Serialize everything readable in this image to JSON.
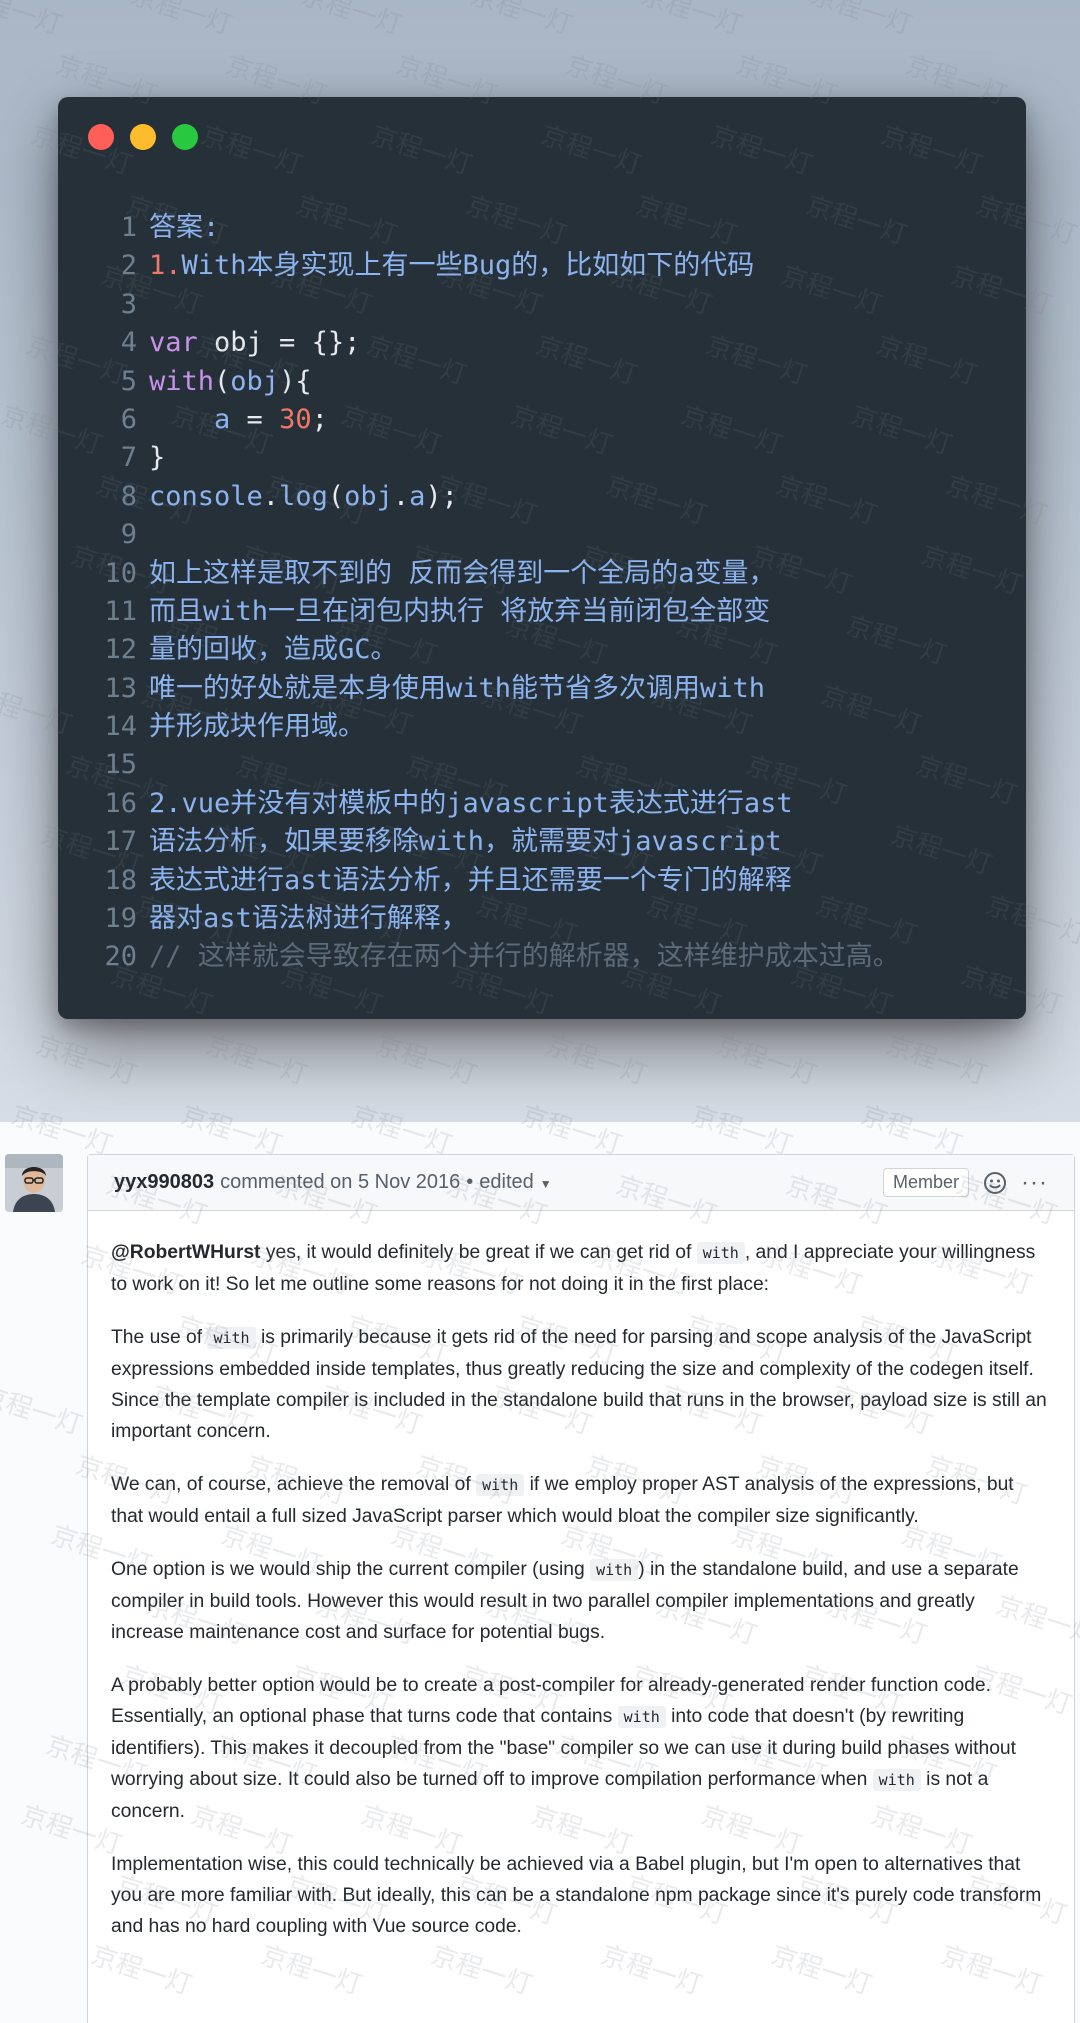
{
  "watermark": "京程一灯",
  "code": {
    "line_numbers": [
      "1",
      "2",
      "3",
      "4",
      "5",
      "6",
      "7",
      "8",
      "9",
      "10",
      "11",
      "12",
      "13",
      "14",
      "15",
      "16",
      "17",
      "18",
      "19",
      "20"
    ],
    "lines": [
      [
        {
          "t": "答案:",
          "c": "text"
        }
      ],
      [
        {
          "t": "1.",
          "c": "num"
        },
        {
          "t": "With本身实现上有一些Bug的，比如如下的代码",
          "c": "text"
        }
      ],
      [],
      [
        {
          "t": "var",
          "c": "kw"
        },
        {
          "t": " obj = {};",
          "c": "var"
        }
      ],
      [
        {
          "t": "with",
          "c": "kw"
        },
        {
          "t": "(",
          "c": "var"
        },
        {
          "t": "obj",
          "c": "prop"
        },
        {
          "t": "){",
          "c": "var"
        }
      ],
      [
        {
          "t": "    ",
          "c": "var"
        },
        {
          "t": "a",
          "c": "prop"
        },
        {
          "t": " = ",
          "c": "var"
        },
        {
          "t": "30",
          "c": "num"
        },
        {
          "t": ";",
          "c": "var"
        }
      ],
      [
        {
          "t": "}",
          "c": "var"
        }
      ],
      [
        {
          "t": "console",
          "c": "prop"
        },
        {
          "t": ".",
          "c": "var"
        },
        {
          "t": "log",
          "c": "prop"
        },
        {
          "t": "(",
          "c": "var"
        },
        {
          "t": "obj",
          "c": "prop"
        },
        {
          "t": ".",
          "c": "var"
        },
        {
          "t": "a",
          "c": "prop"
        },
        {
          "t": ");",
          "c": "var"
        }
      ],
      [],
      [
        {
          "t": "如上这样是取不到的 反而会得到一个全局的a变量，",
          "c": "text"
        }
      ],
      [
        {
          "t": "而且with一旦在闭包内执行 将放弃当前闭包全部变",
          "c": "text"
        }
      ],
      [
        {
          "t": "量的回收，造成GC。",
          "c": "text"
        }
      ],
      [
        {
          "t": "唯一的好处就是本身使用with能节省多次调用with",
          "c": "text"
        }
      ],
      [
        {
          "t": "并形成块作用域。",
          "c": "text"
        }
      ],
      [],
      [
        {
          "t": "2.vue并没有对模板中的javascript表达式进行ast",
          "c": "text"
        }
      ],
      [
        {
          "t": "语法分析，如果要移除with，就需要对javascript",
          "c": "text"
        }
      ],
      [
        {
          "t": "表达式进行ast语法分析，并且还需要一个专门的解释",
          "c": "text"
        }
      ],
      [
        {
          "t": "器对ast语法树进行解释，",
          "c": "text"
        }
      ],
      [
        {
          "t": "// 这样就会导致存在两个并行的解析器，这样维护成本过高。",
          "c": "cmt"
        }
      ]
    ]
  },
  "comment": {
    "author": "yyx990803",
    "action": "commented on 5 Nov 2016",
    "separator": "•",
    "edited": "edited",
    "role_badge": "Member",
    "more": "···",
    "paragraphs": [
      {
        "mention": "@RobertWHurst",
        "before": " yes, it would definitely be great if we can get rid of ",
        "code": "with",
        "after": ", and I appreciate your willingness to work on it! So let me outline some reasons for not doing it in the first place:"
      },
      {
        "before": "The use of ",
        "code": "with",
        "after": " is primarily because it gets rid of the need for parsing and scope analysis of the JavaScript expressions embedded inside templates, thus greatly reducing the size and complexity of the codegen itself. Since the template compiler is included in the standalone build that runs in the browser, payload size is still an important concern."
      },
      {
        "before": "We can, of course, achieve the removal of ",
        "code": "with",
        "after": " if we employ proper AST analysis of the expressions, but that would entail a full sized JavaScript parser which would bloat the compiler size significantly."
      },
      {
        "before": "One option is we would ship the current compiler (using ",
        "code": "with",
        "after": ") in the standalone build, and use a separate compiler in build tools. However this would result in two parallel compiler implementations and greatly increase maintenance cost and surface for potential bugs."
      },
      {
        "before": "A probably better option would be to create a post-compiler for already-generated render function code. Essentially, an optional phase that turns code that contains ",
        "code": "with",
        "middle": " into code that doesn't (by rewriting identifiers). This makes it decoupled from the \"base\" compiler so we can use it during build phases without worrying about size. It could also be turned off to improve compilation performance when ",
        "code2": "with",
        "after": " is not a concern."
      },
      {
        "before": "Implementation wise, this could technically be achieved via a Babel plugin, but I'm open to alternatives that you are more familiar with. But ideally, this can be a standalone npm package since it's purely code transform and has no hard coupling with Vue source code."
      }
    ]
  }
}
